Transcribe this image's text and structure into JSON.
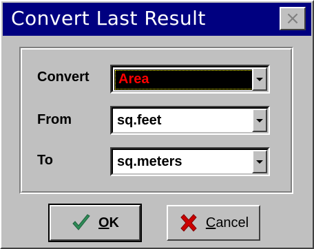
{
  "window": {
    "title": "Convert Last Result",
    "close_glyph": "×"
  },
  "form": {
    "convert": {
      "label": "Convert",
      "value": "Area"
    },
    "from": {
      "label": "From",
      "value": "sq.feet"
    },
    "to": {
      "label": "To",
      "value": "sq.meters"
    }
  },
  "buttons": {
    "ok": {
      "accel": "O",
      "rest": "K",
      "icon": "checkmark-icon"
    },
    "cancel": {
      "accel": "C",
      "rest": "ancel",
      "icon": "x-icon"
    }
  },
  "colors": {
    "titlebar": "#000080",
    "face": "#c0c0c0",
    "highlight_text": "#ff0000",
    "ok_check": "#2e8b57",
    "cancel_x": "#cc0000"
  }
}
